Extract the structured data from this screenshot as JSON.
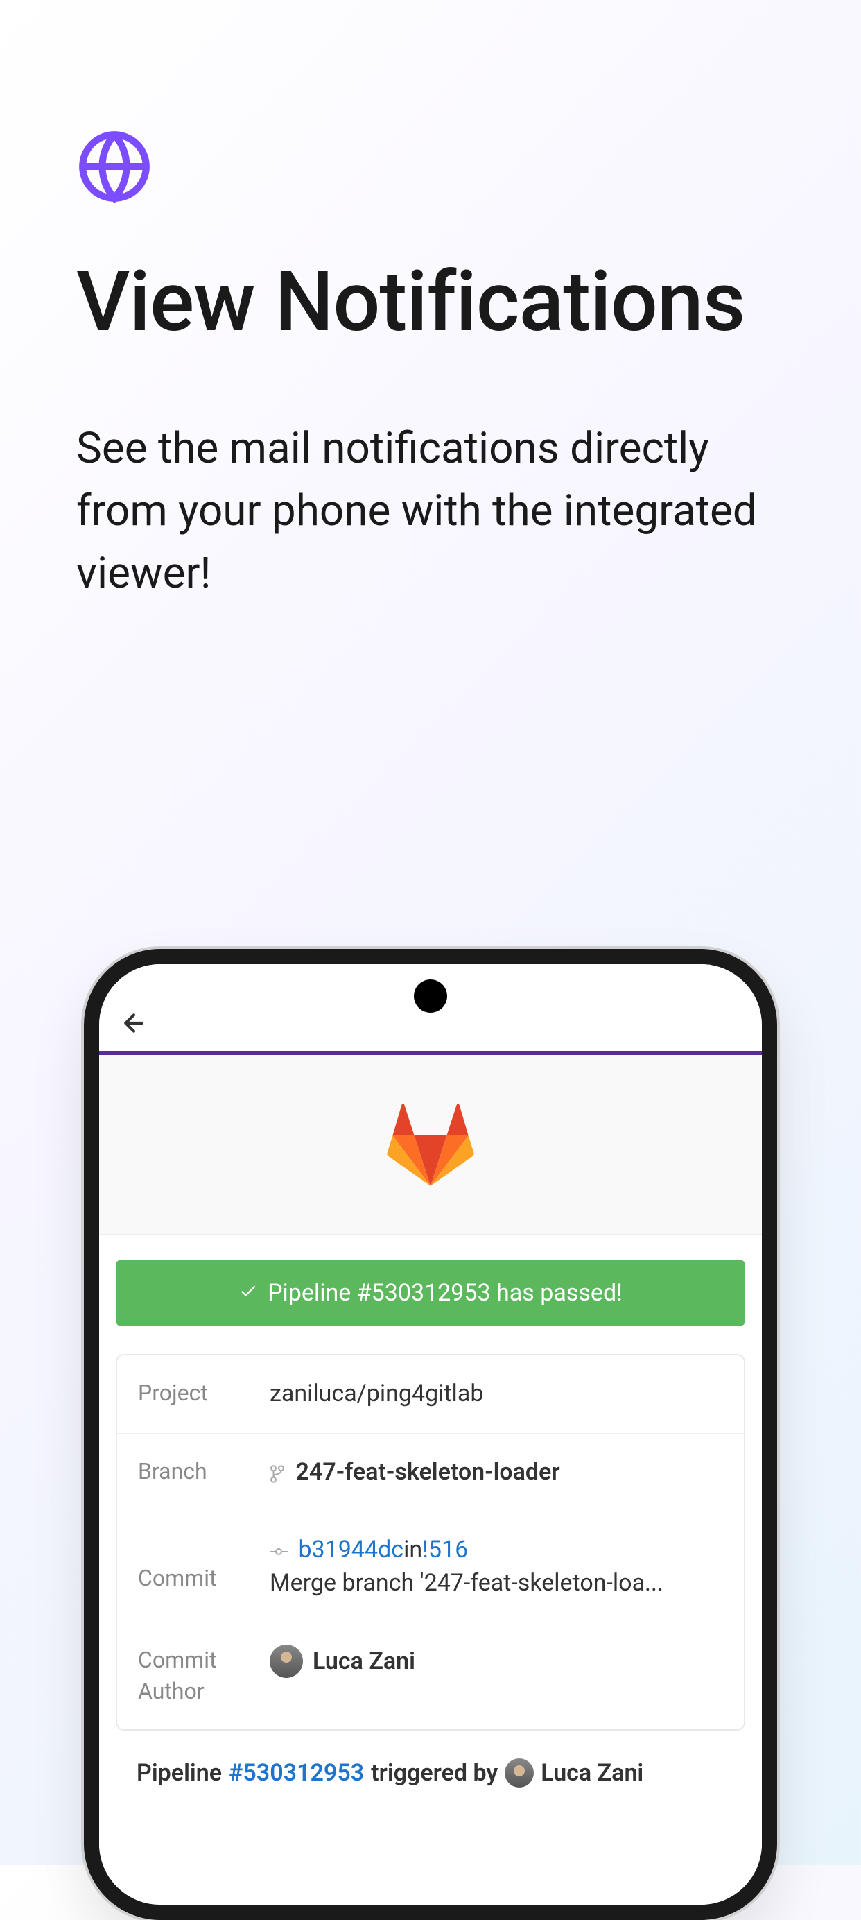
{
  "hero": {
    "title": "View Notifications",
    "subtitle": "See the mail notifications directly from your phone with the integrated viewer!"
  },
  "screen": {
    "status_banner": "Pipeline #530312953 has passed!",
    "rows": {
      "project": {
        "label": "Project",
        "value": "zaniluca/ping4gitlab"
      },
      "branch": {
        "label": "Branch",
        "value": "247-feat-skeleton-loader"
      },
      "commit": {
        "label": "Commit",
        "hash": "b31944dc",
        "in_text": "in",
        "mr": "!516",
        "message": "Merge branch '247-feat-skeleton-loa..."
      },
      "author": {
        "label": "Commit Author",
        "name": "Luca Zani"
      }
    },
    "footer": {
      "prefix": "Pipeline ",
      "pipeline_id": "#530312953",
      "middle": " triggered by ",
      "author": "Luca Zani"
    }
  },
  "colors": {
    "accent": "#7c4dff",
    "success": "#5cb85c",
    "link": "#1f75cb",
    "purple_bar": "#5c2d91"
  }
}
